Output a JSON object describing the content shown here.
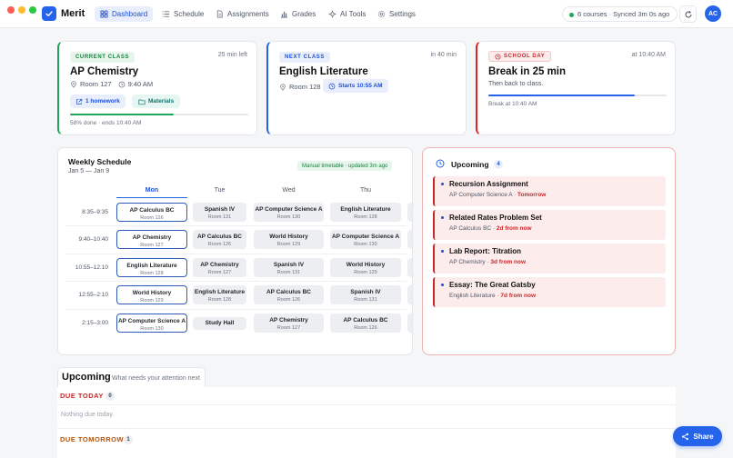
{
  "app": {
    "name": "Merit",
    "avatar": "AC"
  },
  "nav": [
    {
      "label": "Dashboard",
      "icon": "grid-icon",
      "active": true
    },
    {
      "label": "Schedule",
      "icon": "list-icon"
    },
    {
      "label": "Assignments",
      "icon": "document-icon"
    },
    {
      "label": "Grades",
      "icon": "bar-chart-icon"
    },
    {
      "label": "AI Tools",
      "icon": "sparkle-icon"
    },
    {
      "label": "Settings",
      "icon": "gear-icon"
    }
  ],
  "sync": {
    "text": "6 courses · Synced 3m 0s ago"
  },
  "cards": {
    "current": {
      "badge": "CURRENT CLASS",
      "time_left": "25 min left",
      "title": "AP Chemistry",
      "room": "Room 127",
      "time": "9:40 AM",
      "homework_btn": "1 homework",
      "materials_btn": "Materials",
      "progress": 0.58,
      "progress_text": "58% done · ends 10:40 AM"
    },
    "next": {
      "badge": "NEXT CLASS",
      "time_left": "in 40 min",
      "title": "English Literature",
      "room": "Room 128",
      "starts_btn": "Starts 10:55 AM"
    },
    "day": {
      "badge": "SCHOOL DAY",
      "time": "at 10:40 AM",
      "title": "Break in 25 min",
      "subtitle": "Then back to class.",
      "progress": 0.82,
      "footer": "Break at 10:40 AM"
    }
  },
  "schedule": {
    "title": "Weekly Schedule",
    "range": "Jan 5 — Jan 9",
    "status": "Manual timetable · updated 3m ago",
    "days": [
      "Mon",
      "Tue",
      "Wed",
      "Thu"
    ],
    "times": [
      "8:35–9:35",
      "9:40–10:40",
      "10:55–12:10",
      "12:55–2:10",
      "2:15–3:00"
    ],
    "rows": [
      [
        {
          "name": "AP Calculus BC",
          "room": "Room 126"
        },
        {
          "name": "Spanish IV",
          "room": "Room 131"
        },
        {
          "name": "AP Computer Science A",
          "room": "Room 130"
        },
        {
          "name": "English Literature",
          "room": "Room 128"
        }
      ],
      [
        {
          "name": "AP Chemistry",
          "room": "Room 127"
        },
        {
          "name": "AP Calculus BC",
          "room": "Room 126"
        },
        {
          "name": "World History",
          "room": "Room 129"
        },
        {
          "name": "AP Computer Science A",
          "room": "Room 130"
        }
      ],
      [
        {
          "name": "English Literature",
          "room": "Room 128"
        },
        {
          "name": "AP Chemistry",
          "room": "Room 127"
        },
        {
          "name": "Spanish IV",
          "room": "Room 131"
        },
        {
          "name": "World History",
          "room": "Room 129"
        }
      ],
      [
        {
          "name": "World History",
          "room": "Room 129"
        },
        {
          "name": "English Literature",
          "room": "Room 128"
        },
        {
          "name": "AP Calculus BC",
          "room": "Room 126"
        },
        {
          "name": "Spanish IV",
          "room": "Room 131"
        }
      ],
      [
        {
          "name": "AP Computer Science A",
          "room": "Room 130"
        },
        {
          "name": "Study Hall",
          "room": ""
        },
        {
          "name": "AP Chemistry",
          "room": "Room 127"
        },
        {
          "name": "AP Calculus BC",
          "room": "Room 126"
        }
      ]
    ]
  },
  "upcoming_card": {
    "title": "Upcoming",
    "count": "4",
    "items": [
      {
        "name": "Recursion Assignment",
        "course": "AP Computer Science A",
        "sep": " · ",
        "when": "Tomorrow"
      },
      {
        "name": "Related Rates Problem Set",
        "course": "AP Calculus BC",
        "sep": " · ",
        "when": "2d from now"
      },
      {
        "name": "Lab Report: Titration",
        "course": "AP Chemistry",
        "sep": " · ",
        "when": "3d from now"
      },
      {
        "name": "Essay: The Great Gatsby",
        "course": "English Literature",
        "sep": " · ",
        "when": "7d from now"
      }
    ]
  },
  "upcoming_section": {
    "title": "Upcoming",
    "subtitle": "What needs your attention next",
    "due_today": "DUE TODAY",
    "due_today_count": "0",
    "empty_today": "Nothing due today.",
    "due_tomorrow": "DUE TOMORROW",
    "due_tomorrow_count": "1"
  },
  "share": {
    "label": "Share"
  },
  "colors": {
    "accent": "#2563eb",
    "green": "#22a55b",
    "red": "#dc2626"
  }
}
